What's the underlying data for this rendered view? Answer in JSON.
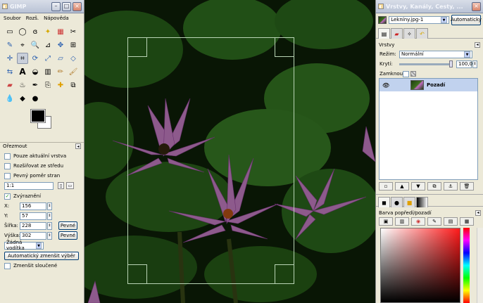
{
  "toolbox": {
    "title": "GIMP",
    "menu": [
      "Soubor",
      "Rozš.",
      "Nápověda"
    ],
    "panel_title": "Ořezmout",
    "options": {
      "current_layer": "Pouze aktuální vrstva",
      "from_center": "Rozšiřovat ze středu",
      "fixed_ratio": "Pevný poměr stran",
      "ratio_value": "1:1",
      "highlight": "Zvýraznění",
      "x_label": "X:",
      "x_value": "156",
      "y_label": "Y:",
      "y_value": "57",
      "width_label": "Šířka:",
      "width_value": "228",
      "height_label": "Výška:",
      "height_value": "302",
      "fixed_label": "Pevné",
      "guides": "Žádná vodítka",
      "auto_shrink": "Automatický zmenšit výběr",
      "shrink_merged": "Zmenšit sloučené"
    }
  },
  "layers": {
    "title": "Vrstvy, Kanály, Cesty, ...",
    "image_name": "Lekníny.jpg-1",
    "auto_button": "Automaticky",
    "section": "Vrstvy",
    "mode_label": "Režim:",
    "mode_value": "Normální",
    "opacity_label": "Krytí:",
    "opacity_value": "100,0",
    "lock_label": "Zamknout:",
    "layer_name": "Pozadí",
    "fg_color_title": "Barva popředí/pozadí"
  },
  "colors": {
    "fg": "#000000",
    "bg": "#ffffff",
    "accent": "#c1d2ee"
  }
}
